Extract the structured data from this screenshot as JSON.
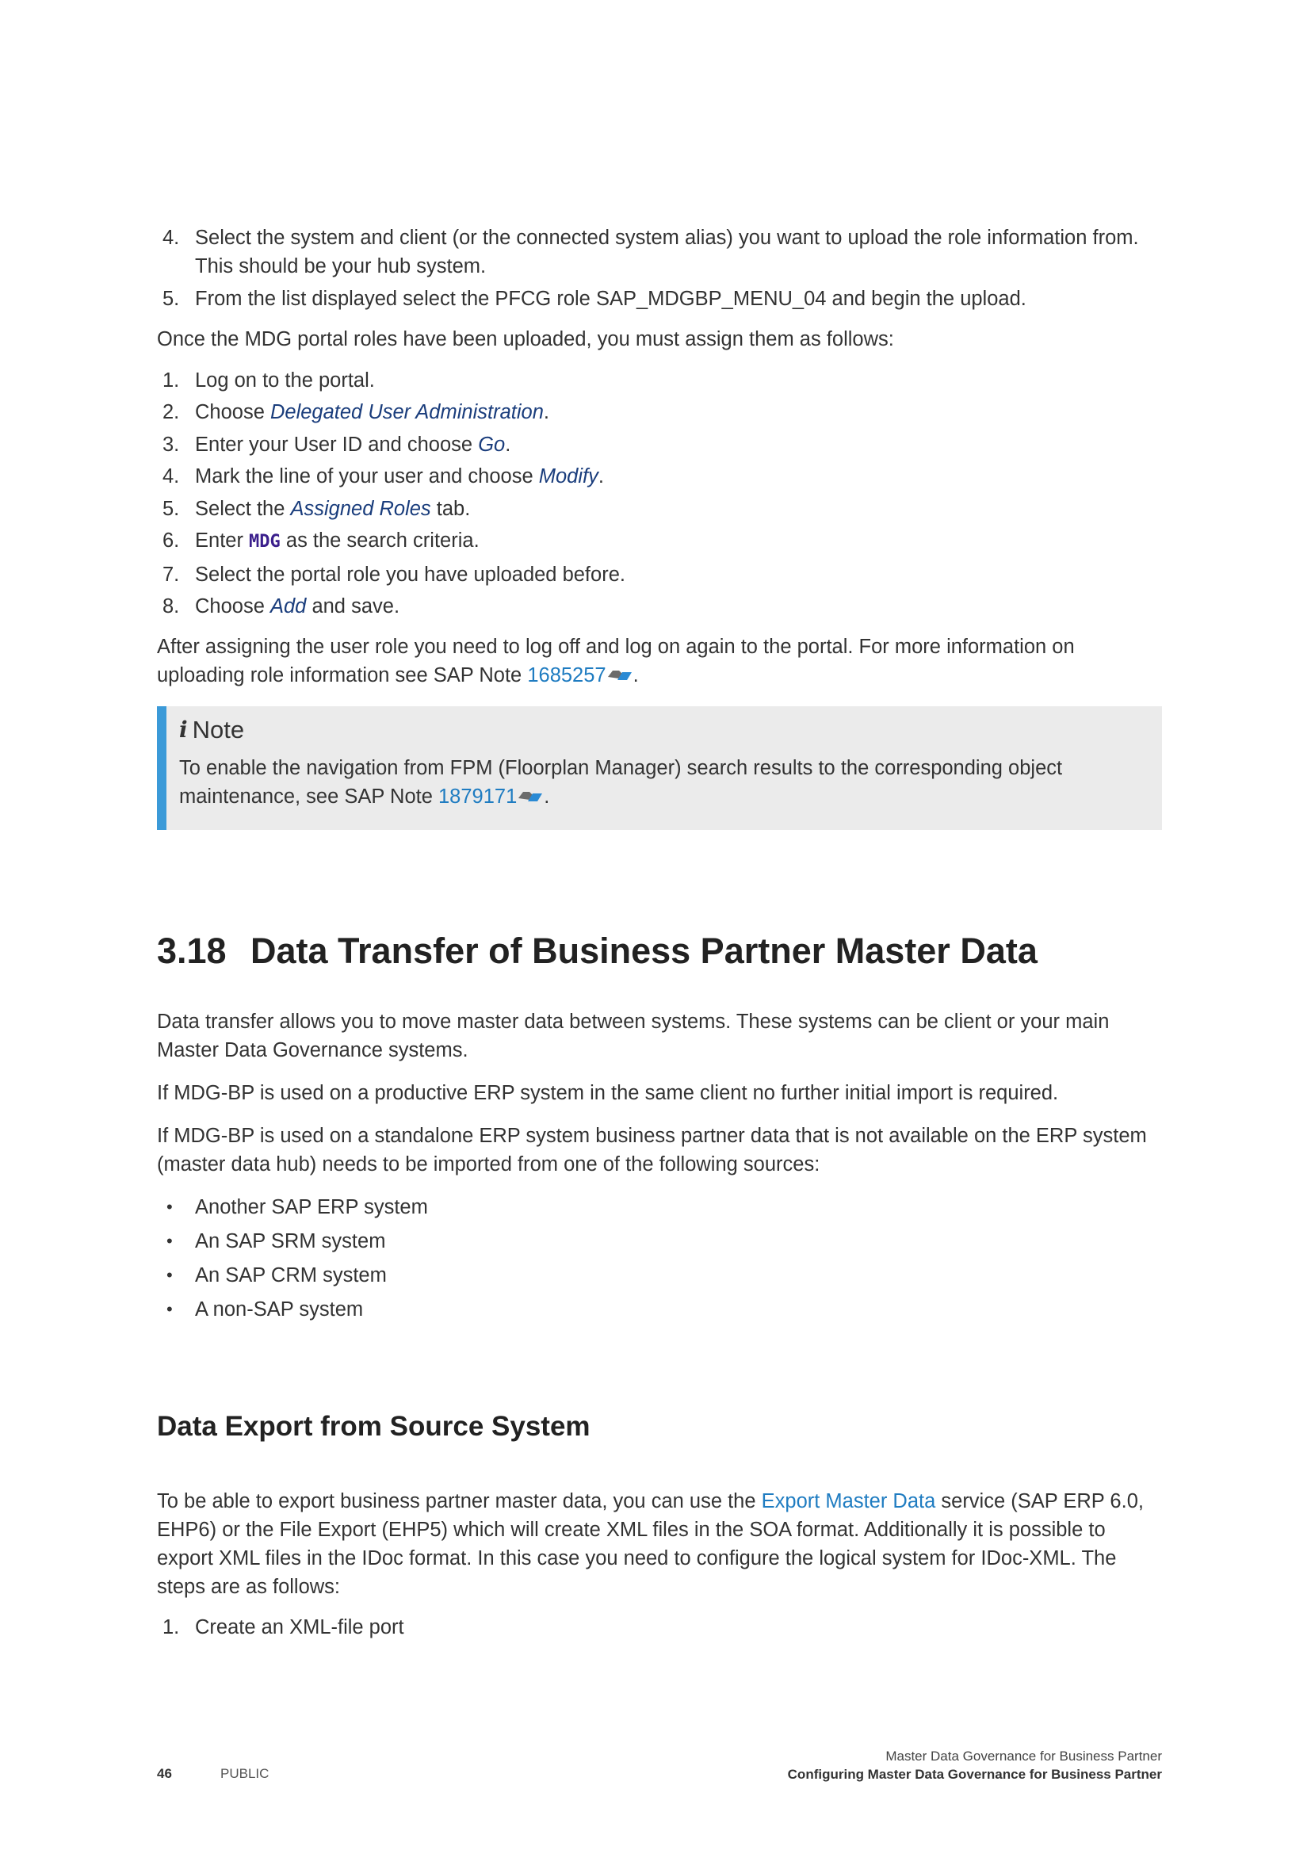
{
  "steps_top": [
    {
      "num": "4.",
      "lines": [
        "Select the system and client (or the connected system alias) you want to upload the role information from.",
        "This should be your hub system."
      ]
    },
    {
      "num": "5.",
      "text": "From the list displayed select the PFCG role SAP_MDGBP_MENU_04 and begin the upload."
    }
  ],
  "assign_intro": "Once the MDG portal roles have been uploaded, you must assign them as follows:",
  "assign_steps": [
    {
      "num": "1.",
      "text": "Log on to the portal."
    },
    {
      "num": "2.",
      "pre": "Choose ",
      "ui": "Delegated User Administration",
      "post": "."
    },
    {
      "num": "3.",
      "pre": "Enter your User ID and choose ",
      "ui": "Go",
      "post": "."
    },
    {
      "num": "4.",
      "pre": "Mark the line of your user and choose ",
      "ui": "Modify",
      "post": "."
    },
    {
      "num": "5.",
      "pre": "Select the ",
      "ui": "Assigned Roles",
      "post": " tab."
    },
    {
      "num": "6.",
      "pre": "Enter ",
      "code": "MDG",
      "post": " as the search criteria."
    },
    {
      "num": "7.",
      "text": "Select the portal role you have uploaded before."
    },
    {
      "num": "8.",
      "pre": "Choose ",
      "ui": "Add",
      "post": " and save."
    }
  ],
  "after_assign": {
    "line1": "After assigning the user role you need to log off and log on again to the portal. For more information on",
    "line2_pre": "uploading role information see SAP Note ",
    "note_link": "1685257",
    "line2_post": "."
  },
  "note": {
    "icon": "info-icon",
    "title": "Note",
    "line1": "To enable the navigation from FPM (Floorplan Manager) search results to the corresponding object",
    "line2_pre": "maintenance, see SAP Note ",
    "link": "1879171",
    "line2_post": "."
  },
  "section": {
    "number": "3.18",
    "title": "Data Transfer of Business Partner Master Data",
    "p1": [
      "Data transfer allows you to move master data between systems. These systems can be client or your main",
      "Master Data Governance systems."
    ],
    "p2": "If MDG-BP is used on a productive ERP system in the same client no further initial import is required.",
    "p3": [
      "If MDG-BP is used on a standalone ERP system business partner data that is not available on the ERP system",
      "(master data hub) needs to be imported from one of the following sources:"
    ],
    "sources": [
      "Another SAP ERP system",
      "An SAP SRM system",
      "An SAP CRM system",
      "A non-SAP system"
    ]
  },
  "subsection": {
    "title": "Data Export from Source System",
    "p_line1_pre": "To be able to export business partner master data, you can use the ",
    "p_link": "Export Master Data",
    "p_line1_post": " service (SAP ERP 6.0,",
    "p_lines": [
      "EHP6) or the File Export (EHP5) which will create XML files in the SOA format. Additionally it is possible to",
      "export XML files in the IDoc format. In this case you need to configure the logical system for IDoc-XML. The",
      "steps are as follows:"
    ],
    "steps": [
      {
        "num": "1.",
        "text": "Create an XML-file port"
      }
    ]
  },
  "footer": {
    "page_number": "46",
    "classification": "PUBLIC",
    "doc_title": "Master Data Governance for Business Partner",
    "chapter": "Configuring Master Data Governance for Business Partner"
  },
  "colors": {
    "link": "#1f7cc1",
    "ui_term": "#1a3d7c",
    "note_bar": "#3b9ad8",
    "note_bg": "#ebebeb"
  }
}
